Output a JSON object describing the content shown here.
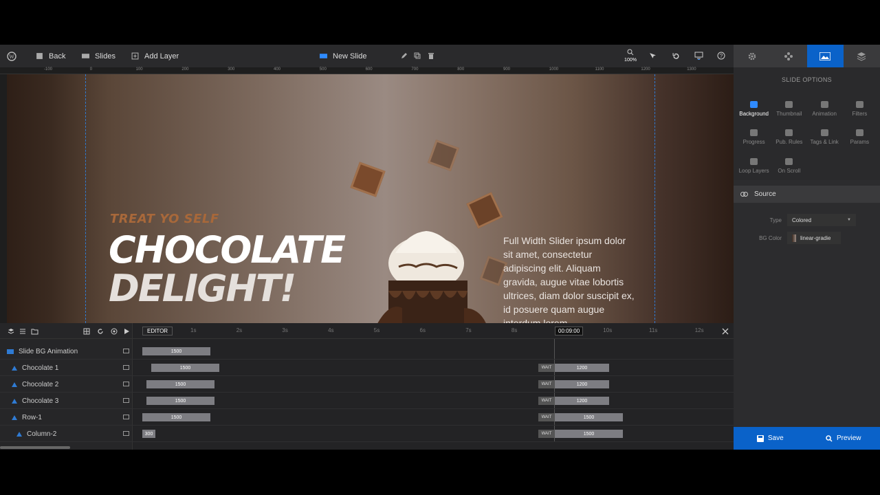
{
  "toolbar": {
    "back_label": "Back",
    "slides_label": "Slides",
    "add_layer_label": "Add Layer",
    "slide_name": "New Slide",
    "zoom": "100%"
  },
  "ruler": [
    "-100",
    "0",
    "100",
    "200",
    "300",
    "400",
    "500",
    "600",
    "700",
    "800",
    "900",
    "1000",
    "1100",
    "1200",
    "1300"
  ],
  "slide": {
    "subtitle": "TREAT YO SELF",
    "heading_line1": "CHOCOLATE",
    "heading_line2": "DELIGHT!",
    "paragraph": "Full Width Slider ipsum dolor sit amet, consectetur adipiscing elit. Aliquam gravida, augue vitae lobortis ultrices, diam dolor suscipit ex, id posuere quam augue interdum lorem."
  },
  "right_panel": {
    "title": "SLIDE OPTIONS",
    "options": [
      {
        "label": "Background",
        "icon": "image-icon",
        "active": true
      },
      {
        "label": "Thumbnail",
        "icon": "thumbnail-icon"
      },
      {
        "label": "Animation",
        "icon": "film-icon"
      },
      {
        "label": "Filters",
        "icon": "filters-icon"
      },
      {
        "label": "Progress",
        "icon": "timer-icon"
      },
      {
        "label": "Pub. Rules",
        "icon": "clock-icon"
      },
      {
        "label": "Tags & Link",
        "icon": "code-icon"
      },
      {
        "label": "Params",
        "icon": "info-icon"
      },
      {
        "label": "Loop Layers",
        "icon": "loop-icon"
      },
      {
        "label": "On Scroll",
        "icon": "download-icon"
      }
    ],
    "source_label": "Source",
    "type_label": "Type",
    "type_value": "Colored",
    "bgcolor_label": "BG Color",
    "bgcolor_value": "linear-gradie",
    "save_label": "Save",
    "preview_label": "Preview"
  },
  "timeline": {
    "editor_label": "EDITOR",
    "time_display": "00:09:00",
    "ticks": [
      "1s",
      "2s",
      "3s",
      "4s",
      "5s",
      "6s",
      "7s",
      "8s",
      "9s",
      "10s",
      "11s",
      "12s"
    ],
    "wait_label": "WAIT",
    "rows": [
      {
        "name": "Slide BG Animation",
        "bar1": "1500"
      },
      {
        "name": "Chocolate 1",
        "bar1": "1500",
        "bar2": "1200"
      },
      {
        "name": "Chocolate 2",
        "bar1": "1500",
        "bar2": "1200"
      },
      {
        "name": "Chocolate 3",
        "bar1": "1500",
        "bar2": "1200"
      },
      {
        "name": "Row-1",
        "bar1": "1500",
        "bar2": "1500"
      },
      {
        "name": "Column-2",
        "bar1": "300",
        "bar2": "1500"
      }
    ]
  },
  "colors": {
    "accent": "#0a62c9",
    "guide": "#2f7bd4",
    "subtitle": "#a8683a"
  }
}
